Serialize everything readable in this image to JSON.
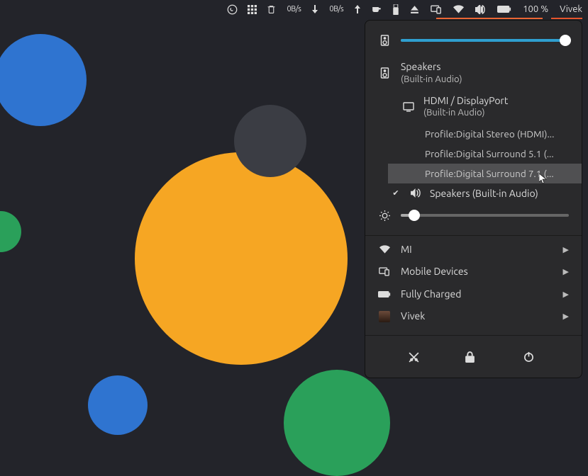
{
  "topbar": {
    "net_down": "0B/s",
    "net_up": "0B/s",
    "battery_percent": "100 %",
    "user": "Vivek"
  },
  "panel": {
    "volume_percent": 98,
    "brightness_percent": 8,
    "output_primary": {
      "title": "Speakers",
      "sub": "(Built-in Audio)"
    },
    "hdmi": {
      "title": "HDMI / DisplayPort",
      "sub": "(Built-in Audio)"
    },
    "profiles": [
      "Profile:Digital Stereo (HDMI)...",
      "Profile:Digital Surround 5.1 (...",
      "Profile:Digital Surround 7.1 (..."
    ],
    "output_selected": {
      "title": "Speakers",
      "sub": "(Built-in Audio)"
    },
    "menu_items": {
      "wifi": "MI",
      "mobile": "Mobile Devices",
      "battery": "Fully Charged",
      "user": "Vivek"
    }
  }
}
